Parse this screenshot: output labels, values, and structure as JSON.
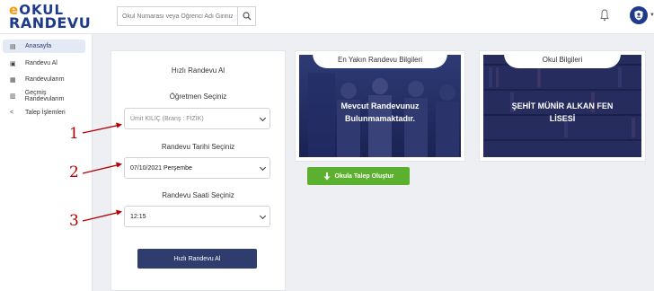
{
  "logo": {
    "mark": "e",
    "okul": "OKUL",
    "randevu": "RANDEVU"
  },
  "search": {
    "placeholder": "Okul Numarası veya Öğrenci Adı Giriniz",
    "icon": "search-icon"
  },
  "header": {
    "bell_icon": "bell-icon",
    "avatar_icon": "user-shield-icon"
  },
  "sidebar": {
    "items": [
      {
        "label": "Anasayfa",
        "icon": "home-icon",
        "active": true
      },
      {
        "label": "Randevu Al",
        "icon": "calendar-icon",
        "active": false
      },
      {
        "label": "Randevularım",
        "icon": "calendar-list-icon",
        "active": false
      },
      {
        "label": "Geçmiş Randevularım",
        "icon": "history-icon",
        "active": false
      },
      {
        "label": "Talep İşlemleri",
        "icon": "share-icon",
        "active": false
      }
    ]
  },
  "form": {
    "title": "Hızlı Randevu Al",
    "teacher_label": "Öğretmen Seçiniz",
    "teacher_value": "Ümit KILIÇ (Branş : FİZİK)",
    "date_label": "Randevu Tarihi Seçiniz",
    "date_value": "07/10/2021 Perşembe",
    "time_label": "Randevu Saati Seçiniz",
    "time_value": "12:15",
    "submit_label": "Hızlı Randevu Al"
  },
  "appointment_card": {
    "title": "En Yakın Randevu Bilgileri",
    "message_line1": "Mevcut Randevunuz",
    "message_line2": "Bulunmamaktadır."
  },
  "school_card": {
    "title": "Okul Bilgileri",
    "name_line1": "ŞEHİT MÜNİR ALKAN FEN",
    "name_line2": "LİSESİ"
  },
  "request_button": {
    "label": "Okula Talep Oluştur",
    "icon": "download-icon"
  },
  "annotations": [
    "1",
    "2",
    "3"
  ],
  "colors": {
    "primary": "#2f3c6e",
    "green": "#5bb12f",
    "annotation": "#b40000",
    "logo_orange": "#f39c12"
  }
}
